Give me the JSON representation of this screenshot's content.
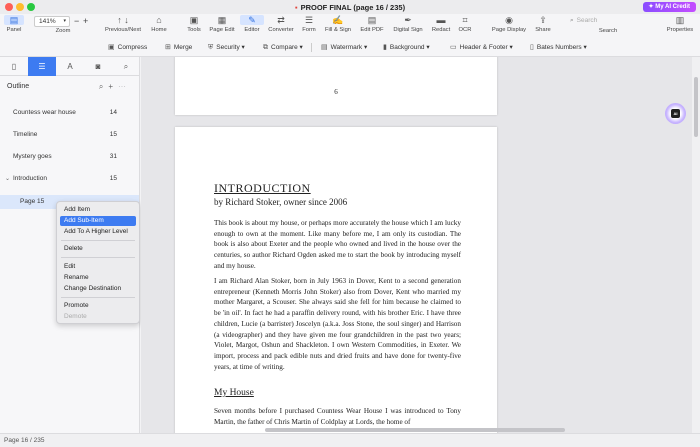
{
  "window": {
    "title": "PROOF FINAL (page 16 / 235)",
    "ai_credit": "My AI Credit"
  },
  "toolbar": {
    "panel": "Panel",
    "zoom_value": "141%",
    "zoom_label": "Zoom",
    "prevnext": "Previous/Next",
    "home": "Home",
    "tools": "Tools",
    "page_edit": "Page Edit",
    "editor": "Editor",
    "converter": "Converter",
    "form": "Form",
    "fill_sign": "Fill & Sign",
    "edit_pdf": "Edit PDF",
    "digital_sign": "Digital Sign",
    "redact": "Redact",
    "ocr": "OCR",
    "page_display": "Page Display",
    "share": "Share",
    "search_placeholder": "Search",
    "search_label": "Search",
    "properties": "Properties"
  },
  "subtoolbar": {
    "compress": "Compress",
    "merge": "Merge",
    "security": "Security",
    "compare": "Compare",
    "watermark": "Watermark",
    "background": "Background",
    "header_footer": "Header & Footer",
    "bates": "Bates Numbers"
  },
  "sidebar": {
    "outline_title": "Outline",
    "items": [
      {
        "label": "Countess wear house",
        "page": "14"
      },
      {
        "label": "Timeline",
        "page": "15"
      },
      {
        "label": "Mystery goes",
        "page": "31"
      },
      {
        "label": "Introduction",
        "page": "15"
      },
      {
        "label": "Page 15",
        "page": ""
      }
    ]
  },
  "context_menu": {
    "add_item": "Add Item",
    "add_sub_item": "Add Sub-Item",
    "add_higher": "Add To A Higher Level",
    "delete": "Delete",
    "edit": "Edit",
    "rename": "Rename",
    "change_dest": "Change Destination",
    "promote": "Promote",
    "demote": "Demote"
  },
  "document": {
    "prev_page_number": "6",
    "title": "INTRODUCTION",
    "subtitle": "by Richard Stoker, owner since 2006",
    "para1": "This book is about my house, or perhaps more accurately the house which I am lucky enough to own at the moment. Like many before me, I am only its custodian. The book is also about Exeter and the people who owned and lived in the house over the centuries, so author Richard Ogden asked me to start the book by introducing myself and my house.",
    "para2": "I am Richard Alan Stoker, born in July 1963 in Dover, Kent to a second generation entrepreneur (Kenneth Morris John Stoker) also from Dover, Kent who married my mother Margaret, a Scouser. She always said she fell for him because he claimed to be 'in oil'. In fact he had a paraffin delivery round, with his brother Eric. I have three children, Lucie (a barrister) Joscelyn (a.k.a. Joss Stone, the soul singer) and Harrison (a videographer) and they have given me four grandchildren in the past two years; Violet, Margot, Oshun and Shackleton. I own Western Commodities, in Exeter. We import, process and pack edible nuts and dried fruits and have done for twenty-five years, at time of writing.",
    "heading2": "My House",
    "para3": "Seven months before I purchased Countess Wear House I was introduced to Tony Martin, the father of Chris Martin of Coldplay at Lords, the home of"
  },
  "ai_assistant": {
    "badge": "AI"
  },
  "status": {
    "page_indicator": "Page 16 / 235"
  }
}
